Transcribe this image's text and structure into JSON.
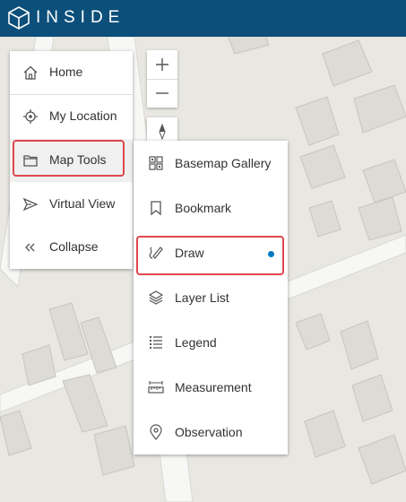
{
  "app": {
    "title": "INSIDE"
  },
  "colors": {
    "header": "#0b4f7a",
    "highlight": "#e0474c",
    "active_dot": "#0079c1"
  },
  "main_menu": {
    "items": [
      {
        "label": "Home",
        "icon": "home-icon"
      },
      {
        "label": "My Location",
        "icon": "location-crosshair-icon"
      },
      {
        "label": "Map Tools",
        "icon": "folder-icon",
        "selected": true
      },
      {
        "label": "Virtual View",
        "icon": "virtual-view-icon"
      },
      {
        "label": "Collapse",
        "icon": "collapse-chevrons-icon"
      }
    ]
  },
  "map_controls": {
    "zoom_in": "+",
    "zoom_out": "—",
    "compass": "compass-icon"
  },
  "tools_menu": {
    "items": [
      {
        "label": "Basemap Gallery",
        "icon": "basemap-gallery-icon"
      },
      {
        "label": "Bookmark",
        "icon": "bookmark-icon"
      },
      {
        "label": "Draw",
        "icon": "draw-icon",
        "selected": true,
        "active": true
      },
      {
        "label": "Layer List",
        "icon": "layers-icon"
      },
      {
        "label": "Legend",
        "icon": "legend-icon"
      },
      {
        "label": "Measurement",
        "icon": "measurement-icon"
      },
      {
        "label": "Observation",
        "icon": "location-pin-icon"
      }
    ]
  }
}
